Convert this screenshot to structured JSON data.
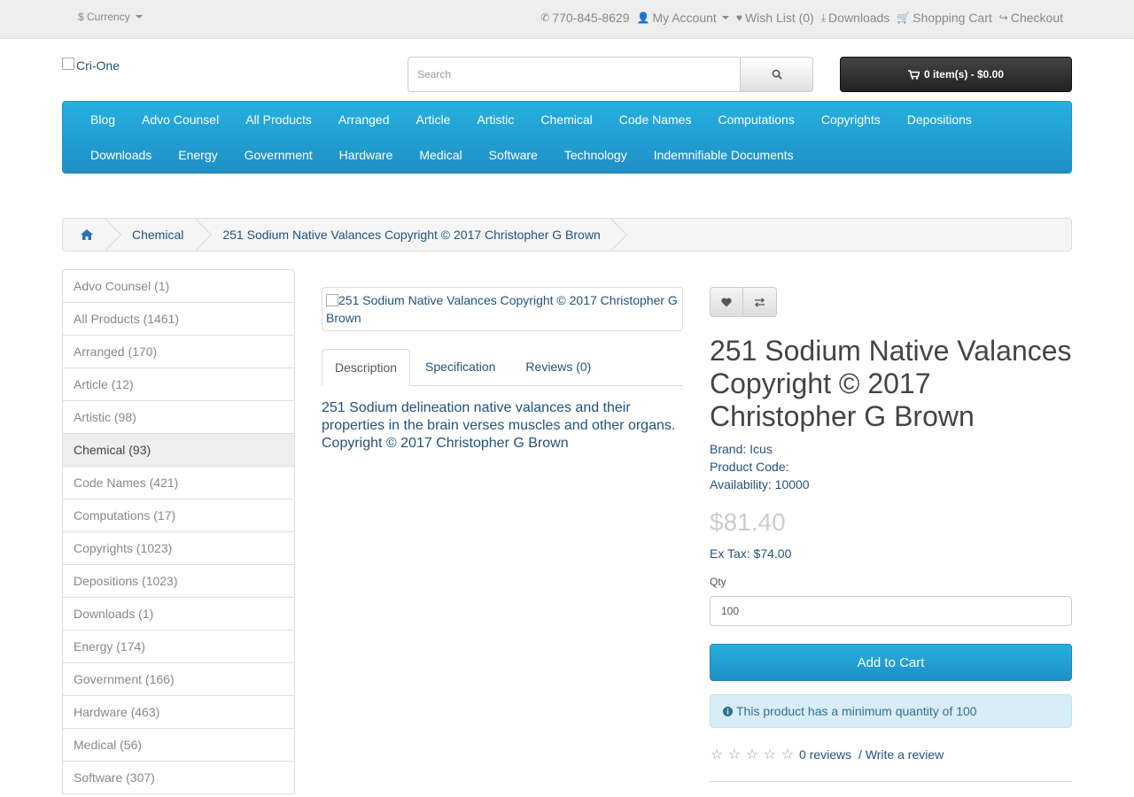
{
  "top_bar": {
    "currency_label": "$ Currency",
    "links": [
      {
        "icon": "phone-icon",
        "glyph": "✆",
        "label": "770-845-8629"
      },
      {
        "icon": "user-icon",
        "glyph": "👤",
        "label": "My Account"
      },
      {
        "icon": "heart-icon",
        "glyph": "♥",
        "label": "Wish List (0)"
      },
      {
        "icon": "download-icon",
        "glyph": "⤓",
        "label": "Downloads"
      },
      {
        "icon": "shopping-cart-icon",
        "glyph": "🛒",
        "label": "Shopping Cart"
      },
      {
        "icon": "share-icon",
        "glyph": "↪",
        "label": "Checkout"
      }
    ]
  },
  "header": {
    "logo_alt": "Cri-One",
    "search_placeholder": "Search",
    "cart_label": "0 item(s) - $0.00"
  },
  "menu": {
    "row1": [
      "Blog",
      "Advo Counsel",
      "All Products",
      "Arranged",
      "Article",
      "Artistic",
      "Chemical",
      "Code Names",
      "Computations",
      "Copyrights",
      "Depositions"
    ],
    "row2": [
      "Downloads",
      "Energy",
      "Government",
      "Hardware",
      "Medical",
      "Software",
      "Technology",
      "Indemnifiable Documents"
    ]
  },
  "breadcrumb": {
    "items": [
      "Chemical",
      "251 Sodium Native Valances Copyright © 2017 Christopher G Brown"
    ]
  },
  "sidebar": {
    "items": [
      {
        "label": "Advo Counsel (1)",
        "active": false
      },
      {
        "label": "All Products (1461)",
        "active": false
      },
      {
        "label": "Arranged (170)",
        "active": false
      },
      {
        "label": "Article (12)",
        "active": false
      },
      {
        "label": "Artistic (98)",
        "active": false
      },
      {
        "label": "Chemical (93)",
        "active": true
      },
      {
        "label": "Code Names (421)",
        "active": false
      },
      {
        "label": "Computations (17)",
        "active": false
      },
      {
        "label": "Copyrights (1023)",
        "active": false
      },
      {
        "label": "Depositions (1023)",
        "active": false
      },
      {
        "label": "Downloads (1)",
        "active": false
      },
      {
        "label": "Energy (174)",
        "active": false
      },
      {
        "label": "Government (166)",
        "active": false
      },
      {
        "label": "Hardware (463)",
        "active": false
      },
      {
        "label": "Medical (56)",
        "active": false
      },
      {
        "label": "Software (307)",
        "active": false
      }
    ]
  },
  "product": {
    "image_alt": "251 Sodium Native Valances Copyright © 2017 Christopher G Brown",
    "tabs": [
      "Description",
      "Specification",
      "Reviews (0)"
    ],
    "active_tab": 0,
    "description": "251 Sodium delineation native valances and their properties in the brain verses muscles and other organs. Copyright © 2017 Christopher G Brown",
    "title": "251 Sodium Native Valances Copyright © 2017 Christopher G Brown",
    "brand_label": "Brand: ",
    "brand": "Icus",
    "product_code": "Product Code:",
    "availability": "Availability: 10000",
    "price": "$81.40",
    "ex_tax": "Ex Tax: $74.00",
    "qty_label": "Qty",
    "qty_value": "100",
    "add_to_cart": "Add to Cart",
    "min_qty_alert": "This product has a minimum quantity of 100",
    "rating_stars": 0,
    "reviews_link": "0 reviews",
    "rating_sep": " / ",
    "write_review": "Write a review"
  },
  "colors": {
    "menu_blue": "#229ac8",
    "link": "#23527c",
    "alert_bg": "#d9edf7"
  }
}
